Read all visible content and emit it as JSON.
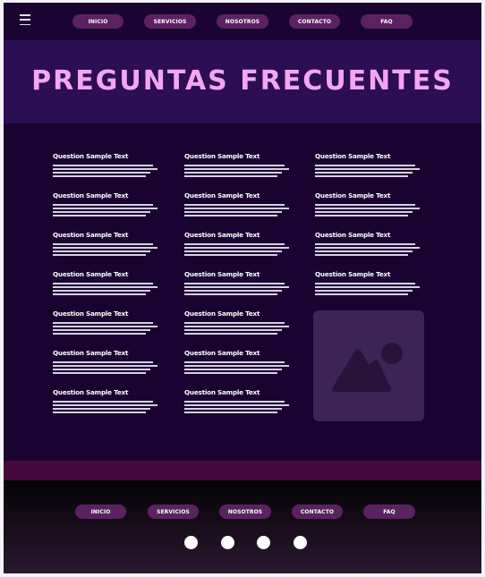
{
  "header": {
    "menu_icon": "hamburger-menu-icon",
    "nav": [
      "INICIO",
      "SERVICIOS",
      "NOSOTROS",
      "CONTACTO",
      "FAQ"
    ]
  },
  "hero": {
    "title": "PREGUNTAS FRECUENTES"
  },
  "faq": {
    "columns": [
      [
        "Question Sample Text",
        "Question Sample Text",
        "Question Sample Text",
        "Question Sample Text",
        "Question Sample Text",
        "Question Sample Text",
        "Question Sample Text"
      ],
      [
        "Question Sample Text",
        "Question Sample Text",
        "Question Sample Text",
        "Question Sample Text",
        "Question Sample Text",
        "Question Sample Text",
        "Question Sample Text"
      ],
      [
        "Question Sample Text",
        "Question Sample Text",
        "Question Sample Text",
        "Question Sample Text"
      ]
    ]
  },
  "image_placeholder": {
    "icon": "image-placeholder-icon"
  },
  "footer": {
    "nav": [
      "INICIO",
      "SERVICIOS",
      "NOSOTROS",
      "CONTACTO",
      "FAQ"
    ],
    "social_icons": [
      "social-icon-1",
      "social-icon-2",
      "social-icon-3",
      "social-icon-4"
    ]
  },
  "colors": {
    "page_bg": "#1a0330",
    "hero_bg": "#2c0e55",
    "title": "#f3a6f0",
    "nav_pill": "#5b2262",
    "footer_band": "#46093c",
    "placeholder": "#3d2454"
  }
}
